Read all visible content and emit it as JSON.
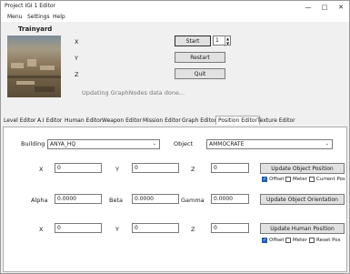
{
  "window": {
    "title": "Project IGI 1 Editor",
    "minimize": "—",
    "maximize": "□",
    "close": "✕"
  },
  "menu": [
    "Menu",
    "Settings",
    "Help"
  ],
  "level_name": "Trainyard",
  "top_controls": {
    "x_label": "X",
    "y_label": "Y",
    "z_label": "Z",
    "start": "Start",
    "restart": "Restart",
    "quit": "Quit",
    "level_number": "1",
    "status": "Updating GraphNodes data done..."
  },
  "tabs": [
    "Level Editor",
    "A.I Editor",
    "Human Editor",
    "Weapon Editor",
    "Mission Editor",
    "Graph Editor",
    "Position Editor",
    "Texture Editor"
  ],
  "active_tab": "Position Editor",
  "position_editor": {
    "building_label": "Building",
    "building_value": "ANYA_HQ",
    "object_label": "Object",
    "object_value": "AMMOCRATE",
    "obj_pos": {
      "x_label": "X",
      "y_label": "Y",
      "z_label": "Z",
      "x": "0",
      "y": "0",
      "z": "0"
    },
    "update_object_position": "Update Object Position",
    "obj_pos_checks": [
      {
        "label": "Offset",
        "checked": true
      },
      {
        "label": "Meter",
        "checked": false
      },
      {
        "label": "Current Pos",
        "checked": false
      }
    ],
    "orientation": {
      "alpha_label": "Alpha",
      "beta_label": "Beta",
      "gamma_label": "Gamma",
      "alpha": "0.0000",
      "beta": "0.0000",
      "gamma": "0.0000"
    },
    "update_object_orientation": "Update Object Orientation",
    "human_pos": {
      "x_label": "X",
      "y_label": "Y",
      "z_label": "Z",
      "x": "0",
      "y": "0",
      "z": "0"
    },
    "update_human_position": "Update Human Position",
    "human_pos_checks": [
      {
        "label": "Offset",
        "checked": true
      },
      {
        "label": "Meter",
        "checked": false
      },
      {
        "label": "Reset Pos",
        "checked": false
      }
    ]
  },
  "colors": {
    "checked": "#1a5fb4",
    "window_bg": "#f0f0f0"
  }
}
